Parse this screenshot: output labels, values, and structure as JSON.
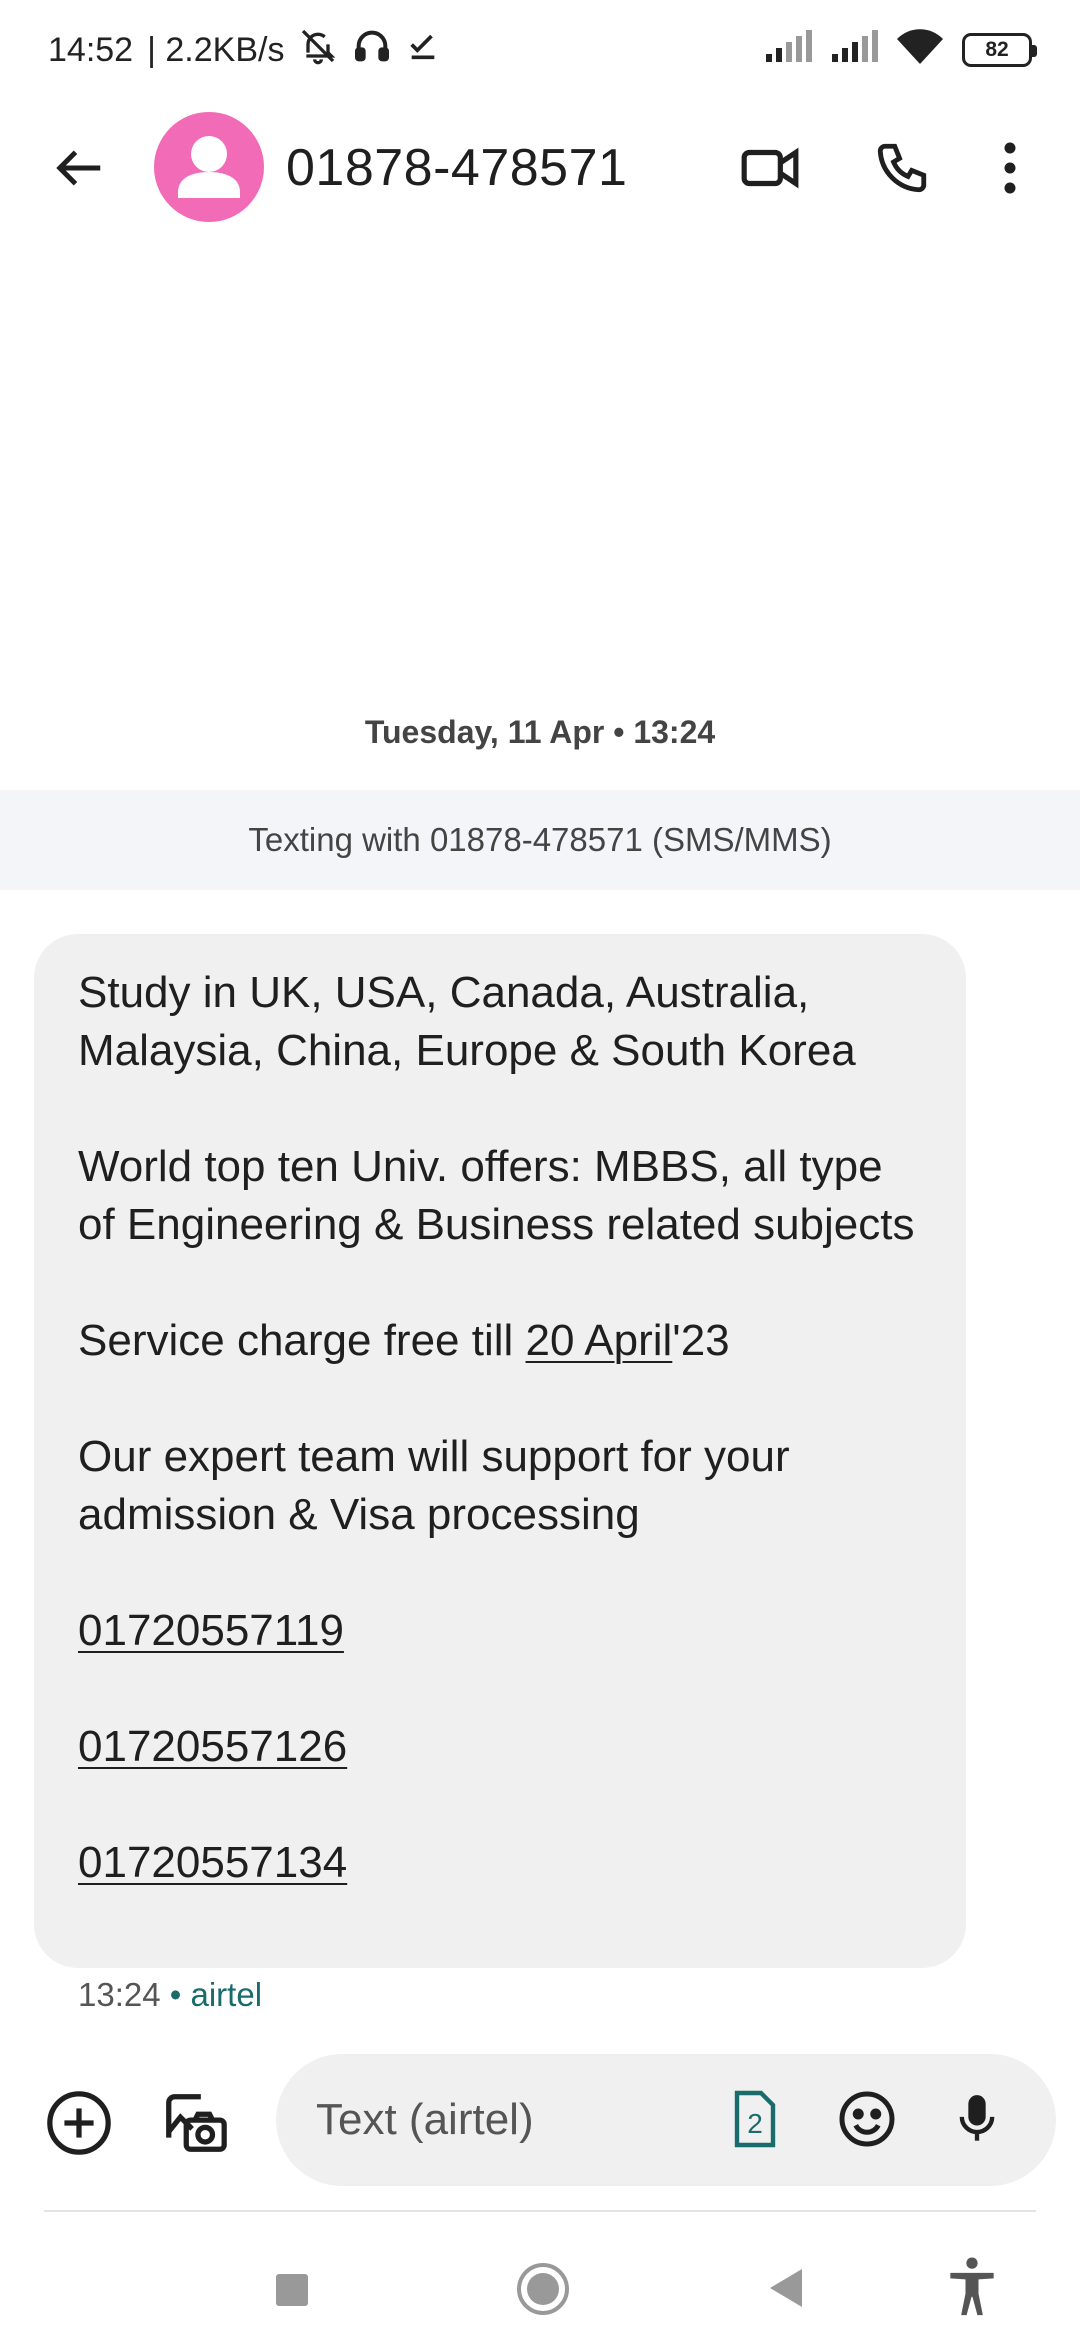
{
  "status_bar": {
    "time": "14:52",
    "network_speed": "| 2.2KB/s",
    "battery": "82",
    "icons": [
      "muted-bell-icon",
      "headphones-icon",
      "check-icon",
      "signal-icon",
      "signal-icon",
      "wifi-icon",
      "battery-icon"
    ]
  },
  "header": {
    "contact": "01878-478571",
    "icons": [
      "back-arrow-icon",
      "person-icon",
      "video-call-icon",
      "phone-icon",
      "more-vert-icon"
    ]
  },
  "thread": {
    "date": "Tuesday, 11 Apr • 13:24",
    "banner": "Texting with 01878-478571 (SMS/MMS)"
  },
  "message": {
    "p1": "Study in UK, USA, Canada, Australia, Malaysia, China, Europe & South Korea",
    "p2": "World top ten Univ. offers: MBBS, all type of Engineering & Business related subjects",
    "p3_prefix": "Service charge free till ",
    "p3_link": "20 April",
    "p3_suffix": "'23",
    "p4": "Our expert team will support for your admission & Visa processing",
    "phone1": "01720557119",
    "phone2": "01720557126",
    "phone3": "01720557134",
    "time": "13:24",
    "separator": "•",
    "carrier": "airtel"
  },
  "compose": {
    "placeholder": "Text (airtel)",
    "value": "",
    "sim_slot": "2",
    "icons": [
      "add-circle-icon",
      "gallery-camera-icon",
      "sim-card-icon",
      "emoji-icon",
      "mic-icon"
    ]
  },
  "nav": {
    "icons": [
      "recents-icon",
      "home-icon",
      "back-icon",
      "accessibility-icon"
    ]
  },
  "colors": {
    "avatar": "#f26bb6",
    "bubble": "#f0f0f0",
    "banner": "#f3f5f8",
    "carrier_accent": "#1a6b6b"
  }
}
